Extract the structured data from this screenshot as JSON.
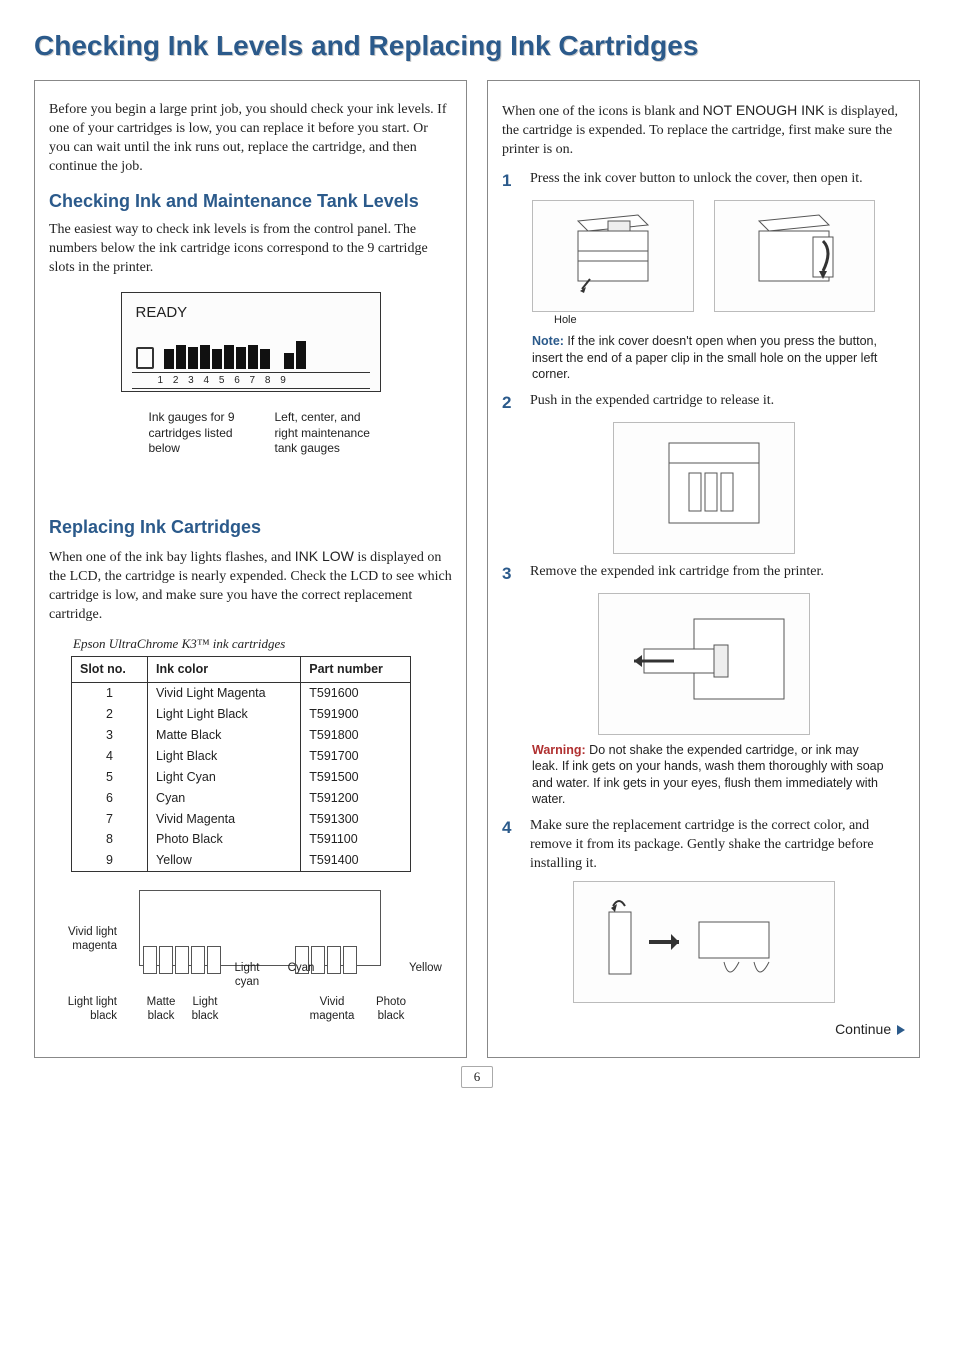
{
  "title": "Checking Ink Levels and Replacing Ink Cartridges",
  "left": {
    "intro": "Before you begin a large print job, you should check your ink levels. If one of your cartridges is low, you can replace it before you start. Or you can wait until the ink runs out, replace the cartridge, and then continue the job.",
    "h2a": "Checking Ink and Maintenance Tank Levels",
    "p2": "The easiest way to check ink levels is from the control panel. The numbers below the ink cartridge icons correspond to the 9 cartridge slots in the printer.",
    "lcd": {
      "ready": "READY",
      "numbers": "1 2 3 4 5 6 7 8 9",
      "cap1": "Ink gauges for 9 cartridges listed below",
      "cap2": "Left, center, and right maintenance tank gauges"
    },
    "h2b": "Replacing Ink Cartridges",
    "p3a": "When one of the ink bay lights flashes, and ",
    "p3b": "INK LOW",
    "p3c": " is displayed on the LCD, the cartridge is nearly expended. Check the LCD to see which cartridge is low, and make sure you have the correct replacement cartridge.",
    "tablecap": "Epson UltraChrome K3™ ink cartridges",
    "th": {
      "slot": "Slot no.",
      "color": "Ink color",
      "part": "Part number"
    },
    "rows": [
      {
        "slot": "1",
        "color": "Vivid Light Magenta",
        "part": "T591600"
      },
      {
        "slot": "2",
        "color": "Light Light Black",
        "part": "T591900"
      },
      {
        "slot": "3",
        "color": "Matte Black",
        "part": "T591800"
      },
      {
        "slot": "4",
        "color": "Light Black",
        "part": "T591700"
      },
      {
        "slot": "5",
        "color": "Light Cyan",
        "part": "T591500"
      },
      {
        "slot": "6",
        "color": "Cyan",
        "part": "T591200"
      },
      {
        "slot": "7",
        "color": "Vivid Magenta",
        "part": "T591300"
      },
      {
        "slot": "8",
        "color": "Photo Black",
        "part": "T591100"
      },
      {
        "slot": "9",
        "color": "Yellow",
        "part": "T591400"
      }
    ],
    "labels": {
      "vlm": "Vivid light magenta",
      "llb": "Light light black",
      "mb": "Matte black",
      "lb": "Light black",
      "lc": "Light cyan",
      "c": "Cyan",
      "vm": "Vivid magenta",
      "pb": "Photo black",
      "y": "Yellow"
    }
  },
  "right": {
    "p1a": "When one of the icons is blank and ",
    "p1b": "NOT ENOUGH INK",
    "p1c": " is displayed, the cartridge is expended. To replace the cartridge, first make sure the printer is on.",
    "step1": "Press the ink cover button to unlock the cover, then open it.",
    "hole": "Hole",
    "note_label": "Note:",
    "note_text": " If the ink cover doesn't open when you press the button, insert the end of a paper clip in the small hole on the upper left corner.",
    "step2": "Push in the expended cartridge to release it.",
    "step3": "Remove the expended ink cartridge from the printer.",
    "warn_label": "Warning:",
    "warn_text": " Do not shake the expended cartridge, or ink may leak. If ink gets on your hands, wash them thoroughly with soap and water. If ink gets in your eyes, flush them immediately with water.",
    "step4": "Make sure the replacement cartridge is the correct color, and remove it from its package. Gently shake the cartridge before installing it.",
    "continue": "Continue"
  },
  "pagenum": "6"
}
